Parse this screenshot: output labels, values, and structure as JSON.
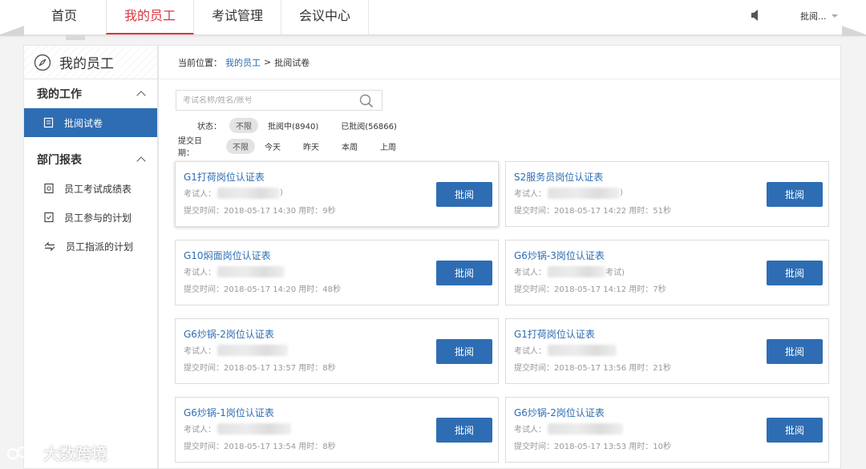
{
  "nav": {
    "items": [
      {
        "label": "首页",
        "name": "nav-home"
      },
      {
        "label": "我的员工",
        "name": "nav-my-staff"
      },
      {
        "label": "考试管理",
        "name": "nav-exam-manage"
      },
      {
        "label": "会议中心",
        "name": "nav-meeting-center"
      }
    ],
    "active": "我的员工",
    "user": "批阅..."
  },
  "sidebar": {
    "title": "我的员工",
    "groups": [
      {
        "label": "我的工作",
        "items": [
          {
            "label": "批阅试卷",
            "icon": "paper-edit-icon",
            "active": true
          }
        ]
      },
      {
        "label": "部门报表",
        "items": [
          {
            "label": "员工考试成绩表",
            "icon": "report-icon"
          },
          {
            "label": "员工参与的计划",
            "icon": "plan-icon"
          },
          {
            "label": "员工指派的计划",
            "icon": "assign-icon"
          }
        ]
      }
    ]
  },
  "breadcrumb": {
    "prefix": "当前位置：",
    "link": "我的员工",
    "sep": ">",
    "current": "批阅试卷"
  },
  "search": {
    "placeholder": "考试名称/姓名/账号"
  },
  "filters": {
    "status": {
      "label": "状态：",
      "options": [
        "不限",
        "批阅中(8940)",
        "已批阅(56866)"
      ],
      "selected": "不限"
    },
    "date": {
      "label": "提交日期：",
      "options": [
        "不限",
        "今天",
        "昨天",
        "本周",
        "上周"
      ],
      "selected": "不限"
    }
  },
  "cards": [
    {
      "title": "G1打荷岗位认证表",
      "examinee_label": "考试人：",
      "examinee_tail": ")",
      "meta": "提交时间：2018-05-17 14:30  用时：9秒",
      "button": "批阅"
    },
    {
      "title": "S2服务员岗位认证表",
      "examinee_label": "考试人：",
      "examinee_tail": ")",
      "meta": "提交时间：2018-05-17 14:22  用时：51秒",
      "button": "批阅"
    },
    {
      "title": "G10焖面岗位认证表",
      "examinee_label": "考试人：",
      "examinee_tail": "",
      "meta": "提交时间：2018-05-17 14:20  用时：48秒",
      "button": "批阅"
    },
    {
      "title": "G6炒锅-3岗位认证表",
      "examinee_label": "考试人：",
      "examinee_tail": "考试)",
      "meta": "提交时间：2018-05-17 14:12  用时：7秒",
      "button": "批阅"
    },
    {
      "title": "G6炒锅-2岗位认证表",
      "examinee_label": "考试人：",
      "examinee_tail": "",
      "meta": "提交时间：2018-05-17 13:57  用时：8秒",
      "button": "批阅"
    },
    {
      "title": "G1打荷岗位认证表",
      "examinee_label": "考试人：",
      "examinee_tail": "",
      "meta": "提交时间：2018-05-17 13:56  用时：21秒",
      "button": "批阅"
    },
    {
      "title": "G6炒锅-1岗位认证表",
      "examinee_label": "考试人：",
      "examinee_tail": "",
      "meta": "提交时间：2018-05-17 13:54  用时：8秒",
      "button": "批阅"
    },
    {
      "title": "G6炒锅-2岗位认证表",
      "examinee_label": "考试人：",
      "examinee_tail": "",
      "meta": "提交时间：2018-05-17 13:53  用时：10秒",
      "button": "批阅"
    }
  ],
  "watermark": "大数跨境",
  "colors": {
    "accent": "#2e6db3",
    "active_nav": "#d9363e"
  }
}
